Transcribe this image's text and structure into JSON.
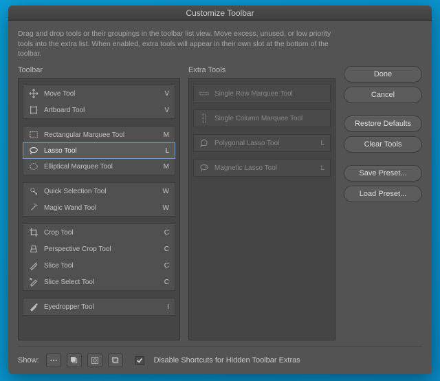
{
  "title": "Customize Toolbar",
  "description": "Drag and drop tools or their groupings in the toolbar list view. Move excess, unused, or low priority tools into the extra list. When enabled, extra tools will appear in their own slot at the bottom of the toolbar.",
  "headers": {
    "toolbar": "Toolbar",
    "extra": "Extra Tools"
  },
  "toolbar_groups": [
    [
      {
        "icon": "move",
        "label": "Move Tool",
        "key": "V"
      },
      {
        "icon": "artboard",
        "label": "Artboard Tool",
        "key": "V"
      }
    ],
    [
      {
        "icon": "rect-marquee",
        "label": "Rectangular Marquee Tool",
        "key": "M"
      },
      {
        "icon": "lasso",
        "label": "Lasso Tool",
        "key": "L",
        "selected": true
      },
      {
        "icon": "ellipse-marquee",
        "label": "Elliptical Marquee Tool",
        "key": "M"
      }
    ],
    [
      {
        "icon": "quick-select",
        "label": "Quick Selection Tool",
        "key": "W"
      },
      {
        "icon": "magic-wand",
        "label": "Magic Wand Tool",
        "key": "W"
      }
    ],
    [
      {
        "icon": "crop",
        "label": "Crop Tool",
        "key": "C"
      },
      {
        "icon": "persp-crop",
        "label": "Perspective Crop Tool",
        "key": "C"
      },
      {
        "icon": "slice",
        "label": "Slice Tool",
        "key": "C"
      },
      {
        "icon": "slice-select",
        "label": "Slice Select Tool",
        "key": "C"
      }
    ],
    [
      {
        "icon": "eyedropper",
        "label": "Eyedropper Tool",
        "key": "I"
      }
    ]
  ],
  "extra_groups": [
    [
      {
        "icon": "row-marquee",
        "label": "Single Row Marquee Tool",
        "key": ""
      }
    ],
    [
      {
        "icon": "col-marquee",
        "label": "Single Column Marquee Tool",
        "key": ""
      }
    ],
    [
      {
        "icon": "poly-lasso",
        "label": "Polygonal Lasso Tool",
        "key": "L"
      }
    ],
    [
      {
        "icon": "mag-lasso",
        "label": "Magnetic Lasso Tool",
        "key": "L"
      }
    ]
  ],
  "buttons": {
    "done": "Done",
    "cancel": "Cancel",
    "restore": "Restore Defaults",
    "clear": "Clear Tools",
    "save": "Save Preset...",
    "load": "Load Preset..."
  },
  "footer": {
    "show": "Show:",
    "checkbox_label": "Disable Shortcuts for Hidden Toolbar Extras",
    "checked": true
  }
}
